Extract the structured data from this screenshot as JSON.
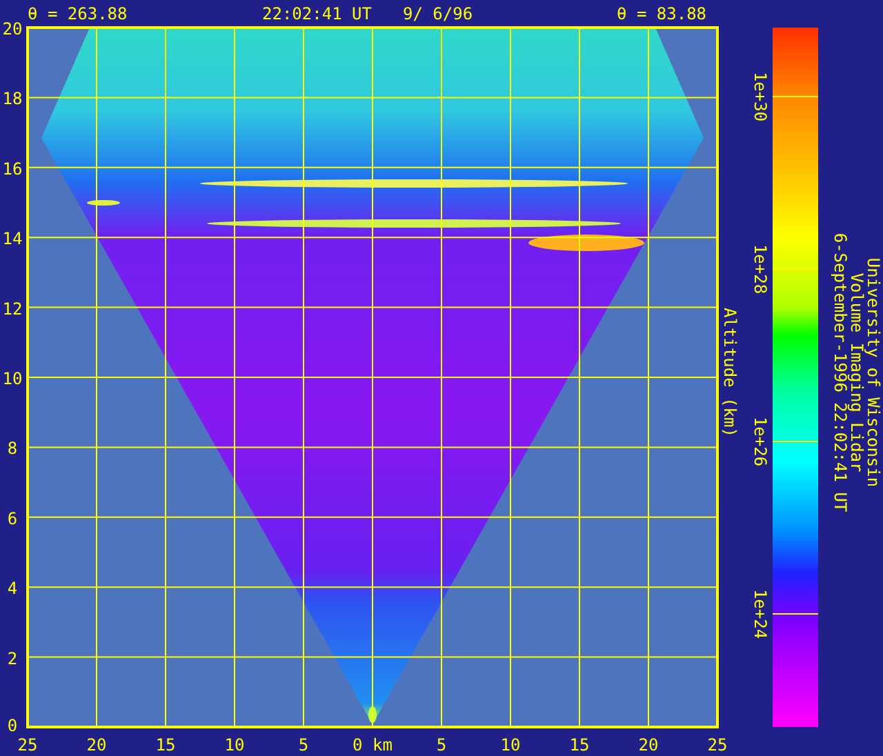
{
  "header": {
    "left_angle": "θ = 263.88",
    "time": "22:02:41 UT",
    "date": "9/ 6/96",
    "right_angle": "θ = 83.88"
  },
  "plot": {
    "y_axis_title": "Altitude (km)",
    "y_ticks": [
      "20",
      "18",
      "16",
      "14",
      "12",
      "10",
      "8",
      "6",
      "4",
      "2",
      "0"
    ],
    "x_ticks": [
      "25",
      "20",
      "15",
      "10",
      "5",
      "0 km",
      "5",
      "10",
      "15",
      "20",
      "25"
    ]
  },
  "color_bar": {
    "ticks": [
      "1e+30",
      "1e+28",
      "1e+26",
      "1e+24"
    ]
  },
  "credits": [
    "University of Wisconsin",
    "Volume Imaging Lidar",
    "6-September-1996 22:02:41 UT"
  ]
}
